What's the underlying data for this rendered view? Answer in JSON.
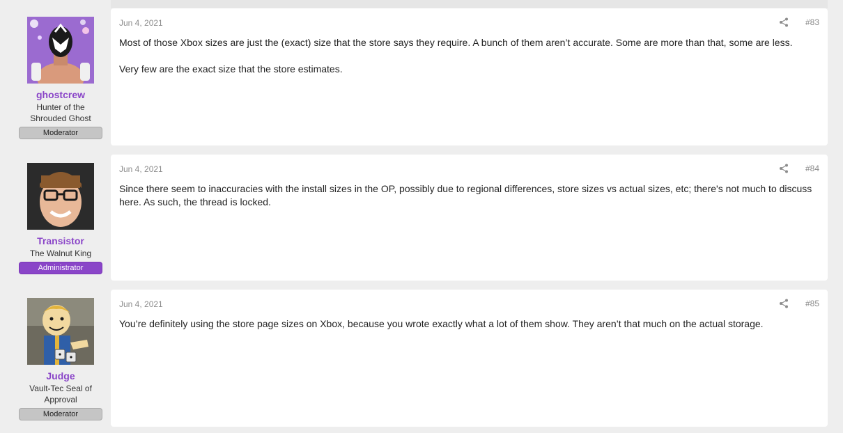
{
  "posts": [
    {
      "author": {
        "name": "ghostcrew",
        "title": "Hunter of the Shrouded Ghost",
        "role": "Moderator",
        "avatar_icon": "masked-wrestler-avatar"
      },
      "date": "Jun 4, 2021",
      "number": "#83",
      "paragraphs": [
        "Most of those Xbox sizes are just the (exact) size that the store says they require. A bunch of them aren’t accurate. Some are more than that, some are less.",
        "Very few are the exact size that the store estimates."
      ]
    },
    {
      "author": {
        "name": "Transistor",
        "title": "The Walnut King",
        "role": "Administrator",
        "avatar_icon": "smiling-man-glasses-avatar"
      },
      "date": "Jun 4, 2021",
      "number": "#84",
      "paragraphs": [
        "Since there seem to inaccuracies with the install sizes in the OP, possibly due to regional differences, store sizes vs actual sizes, etc; there's not much to discuss here. As such, the thread is locked."
      ]
    },
    {
      "author": {
        "name": "Judge",
        "title": "Vault-Tec Seal of Approval",
        "role": "Moderator",
        "avatar_icon": "vault-boy-dice-avatar"
      },
      "date": "Jun 4, 2021",
      "number": "#85",
      "paragraphs": [
        "You’re definitely using the store page sizes on Xbox, because you wrote exactly what a lot of them show. They aren’t that much on the actual storage."
      ]
    }
  ],
  "colors": {
    "username": "#8a45c8",
    "admin_badge": "#8a45c8",
    "mod_badge": "#c5c5c5",
    "page_bg": "#eeeeee"
  },
  "icons": {
    "share": "share-icon"
  }
}
